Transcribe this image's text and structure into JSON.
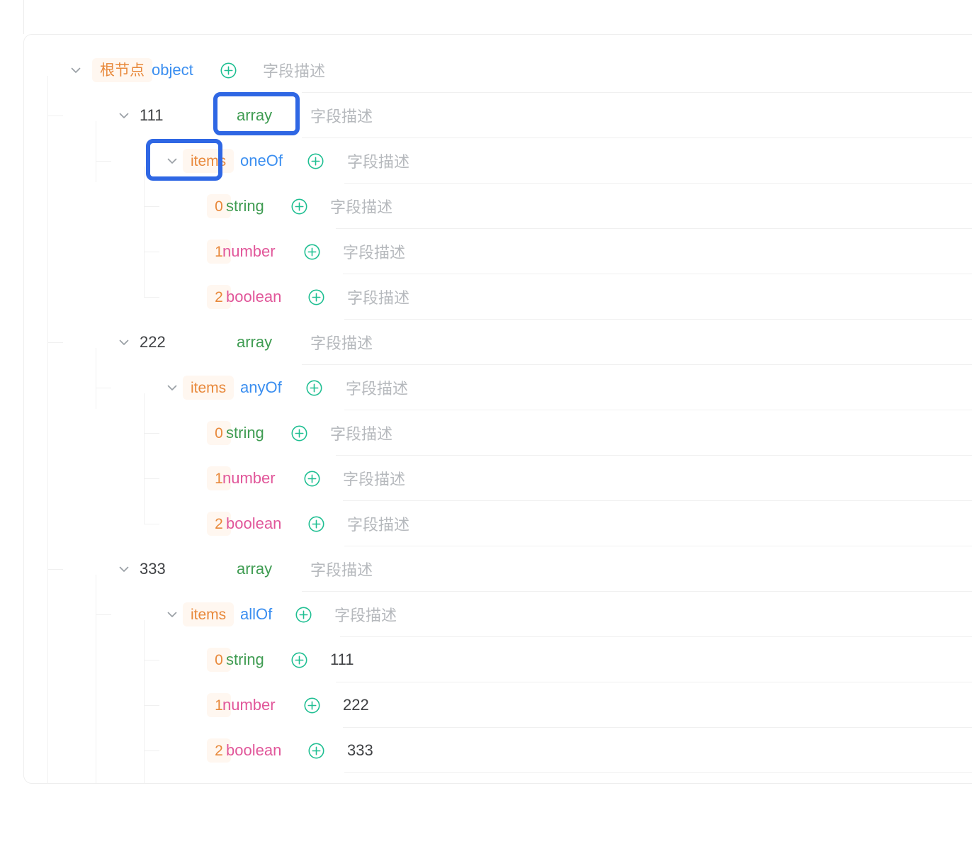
{
  "tree": {
    "placeholder_desc": "字段描述",
    "icons": {
      "expand": "chevron-down-icon",
      "add": "plus-circle-icon"
    },
    "rows": [
      {
        "key": "根节点",
        "key_style": "tag",
        "type": "object",
        "desc": "字段描述",
        "desc_filled": false,
        "has_add": true,
        "has_chevron": true,
        "depth": 0
      },
      {
        "key": "111",
        "key_style": "plain",
        "type": "array",
        "desc": "字段描述",
        "desc_filled": false,
        "has_add": false,
        "has_chevron": true,
        "depth": 1
      },
      {
        "key": "items",
        "key_style": "tag",
        "type": "oneOf",
        "desc": "字段描述",
        "desc_filled": false,
        "has_add": true,
        "has_chevron": true,
        "depth": 2
      },
      {
        "key": "0",
        "key_style": "idx",
        "type": "string",
        "desc": "字段描述",
        "desc_filled": false,
        "has_add": true,
        "has_chevron": false,
        "depth": 3
      },
      {
        "key": "1",
        "key_style": "idx",
        "type": "number",
        "desc": "字段描述",
        "desc_filled": false,
        "has_add": true,
        "has_chevron": false,
        "depth": 3
      },
      {
        "key": "2",
        "key_style": "idx",
        "type": "boolean",
        "desc": "字段描述",
        "desc_filled": false,
        "has_add": true,
        "has_chevron": false,
        "depth": 3
      },
      {
        "key": "222",
        "key_style": "plain",
        "type": "array",
        "desc": "字段描述",
        "desc_filled": false,
        "has_add": false,
        "has_chevron": true,
        "depth": 1
      },
      {
        "key": "items",
        "key_style": "tag",
        "type": "anyOf",
        "desc": "字段描述",
        "desc_filled": false,
        "has_add": true,
        "has_chevron": true,
        "depth": 2
      },
      {
        "key": "0",
        "key_style": "idx",
        "type": "string",
        "desc": "字段描述",
        "desc_filled": false,
        "has_add": true,
        "has_chevron": false,
        "depth": 3
      },
      {
        "key": "1",
        "key_style": "idx",
        "type": "number",
        "desc": "字段描述",
        "desc_filled": false,
        "has_add": true,
        "has_chevron": false,
        "depth": 3
      },
      {
        "key": "2",
        "key_style": "idx",
        "type": "boolean",
        "desc": "字段描述",
        "desc_filled": false,
        "has_add": true,
        "has_chevron": false,
        "depth": 3
      },
      {
        "key": "333",
        "key_style": "plain",
        "type": "array",
        "desc": "字段描述",
        "desc_filled": false,
        "has_add": false,
        "has_chevron": true,
        "depth": 1
      },
      {
        "key": "items",
        "key_style": "tag",
        "type": "allOf",
        "desc": "字段描述",
        "desc_filled": false,
        "has_add": true,
        "has_chevron": true,
        "depth": 2
      },
      {
        "key": "0",
        "key_style": "idx",
        "type": "string",
        "desc": "111",
        "desc_filled": true,
        "has_add": true,
        "has_chevron": false,
        "depth": 3
      },
      {
        "key": "1",
        "key_style": "idx",
        "type": "number",
        "desc": "222",
        "desc_filled": true,
        "has_add": true,
        "has_chevron": false,
        "depth": 3
      },
      {
        "key": "2",
        "key_style": "idx",
        "type": "boolean",
        "desc": "333",
        "desc_filled": true,
        "has_add": true,
        "has_chevron": false,
        "depth": 3
      }
    ]
  },
  "annotations": [
    {
      "label": "array-type-highlight",
      "target": "array"
    },
    {
      "label": "items-key-highlight",
      "target": "items"
    }
  ],
  "colors": {
    "key_tag_text": "#e8883a",
    "key_tag_bg": "#fff7f0",
    "type_object": "#3a8ef0",
    "type_array": "#3f9c52",
    "type_string": "#3f9c52",
    "type_number": "#e1579a",
    "type_boolean": "#e1579a",
    "type_combiner": "#3a8ef0",
    "add_icon": "#1fbf92",
    "placeholder": "#b6b9bd",
    "value_text": "#3f4144",
    "annotation_box": "#2f67e4",
    "separator": "#f0f0f0",
    "card_border": "#eeeeee"
  }
}
